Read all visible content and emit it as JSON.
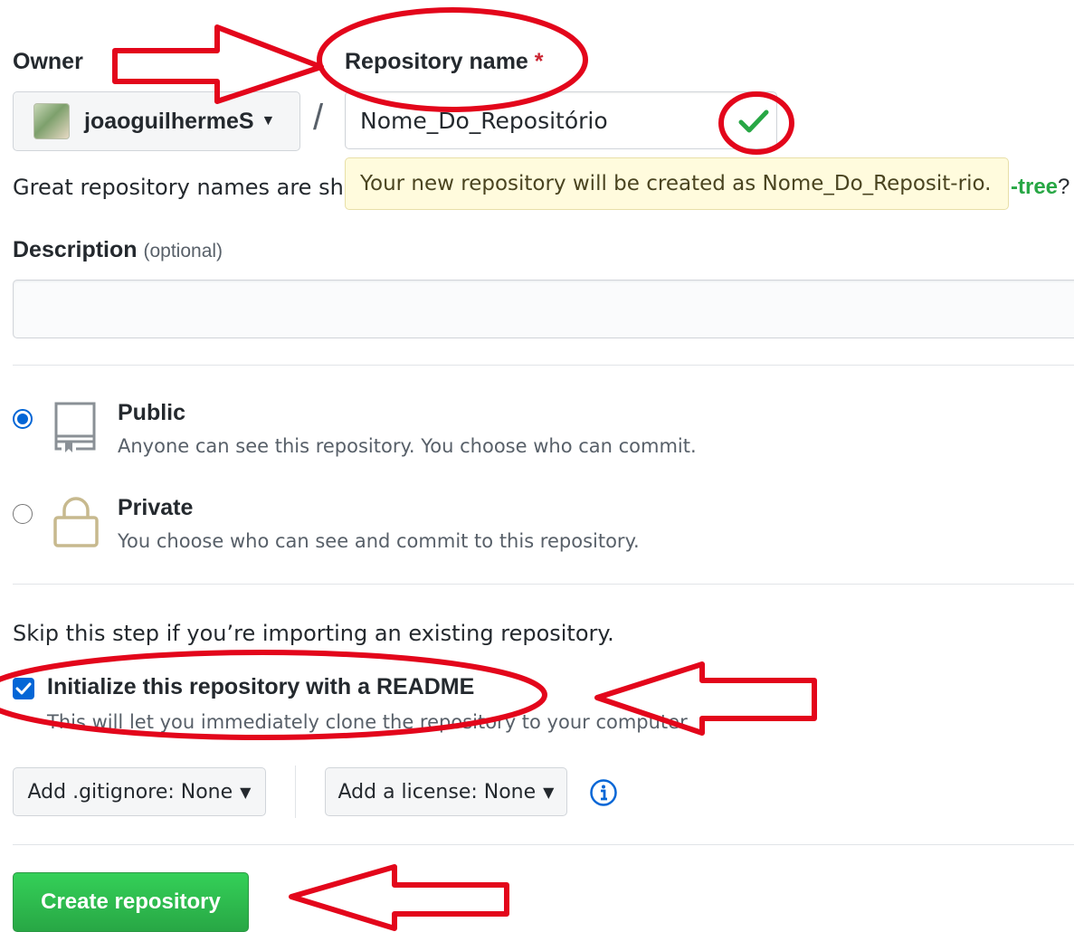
{
  "owner": {
    "label": "Owner",
    "username": "joaoguilhermeS"
  },
  "repo_name": {
    "label": "Repository name",
    "required_mark": "*",
    "separator": "/",
    "value": "Nome_Do_Repositório",
    "tip": "Your new repository will be created as Nome_Do_Reposit-rio.",
    "hint_prefix": "Great repository names are sho",
    "hint_suffix": "-tree",
    "hint_end": "?"
  },
  "description": {
    "label": "Description",
    "optional": "(optional)",
    "value": ""
  },
  "visibility": {
    "public": {
      "title": "Public",
      "desc": "Anyone can see this repository. You choose who can commit.",
      "selected": true
    },
    "private": {
      "title": "Private",
      "desc": "You choose who can see and commit to this repository.",
      "selected": false
    }
  },
  "init": {
    "skip_text": "Skip this step if you’re importing an existing repository.",
    "readme_label": "Initialize this repository with a README",
    "readme_note": "This will let you immediately clone the repository to your computer.",
    "checked": true
  },
  "options": {
    "gitignore": "Add .gitignore: None",
    "license": "Add a license: None"
  },
  "actions": {
    "create": "Create repository"
  },
  "colors": {
    "annotation_red": "#e3061b",
    "primary_green": "#28a745",
    "link_blue": "#0366d6"
  }
}
